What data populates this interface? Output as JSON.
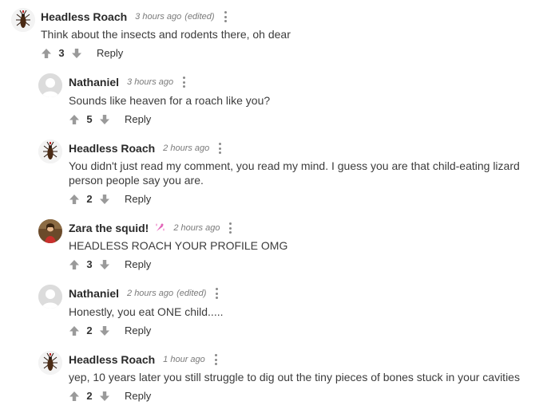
{
  "comments": [
    {
      "author": "Headless Roach",
      "avatar_icon": "cockroach-avatar",
      "time": "3 hours ago",
      "edited": "(edited)",
      "text": "Think about the insects and rodents there, oh dear",
      "votes": "3",
      "reply_label": "Reply"
    },
    {
      "author": "Nathaniel",
      "avatar_icon": "default-user-avatar",
      "time": "3 hours ago",
      "text": "Sounds like heaven for a roach like you?",
      "votes": "5",
      "reply_label": "Reply"
    },
    {
      "author": "Headless Roach",
      "avatar_icon": "cockroach-avatar",
      "time": "2 hours ago",
      "text": "You didn't just read my comment, you read my mind. I guess you are that child-eating lizard person people say you are.",
      "votes": "2",
      "reply_label": "Reply"
    },
    {
      "author": "Zara the squid!",
      "avatar_icon": "person-photo-avatar",
      "badge_icon": "sparkle-badge-icon",
      "time": "2 hours ago",
      "text": "HEADLESS ROACH YOUR PROFILE OMG",
      "votes": "3",
      "reply_label": "Reply"
    },
    {
      "author": "Nathaniel",
      "avatar_icon": "default-user-avatar",
      "time": "2 hours ago",
      "edited": "(edited)",
      "text": "Honestly, you eat ONE child.....",
      "votes": "2",
      "reply_label": "Reply"
    },
    {
      "author": "Headless Roach",
      "avatar_icon": "cockroach-avatar",
      "time": "1 hour ago",
      "text": "yep, 10 years later you still struggle to dig out the tiny pieces of bones stuck in your cavities",
      "votes": "2",
      "reply_label": "Reply"
    }
  ],
  "colors": {
    "vote_arrow": "#9a9a9a",
    "badge": "#e264b8"
  }
}
